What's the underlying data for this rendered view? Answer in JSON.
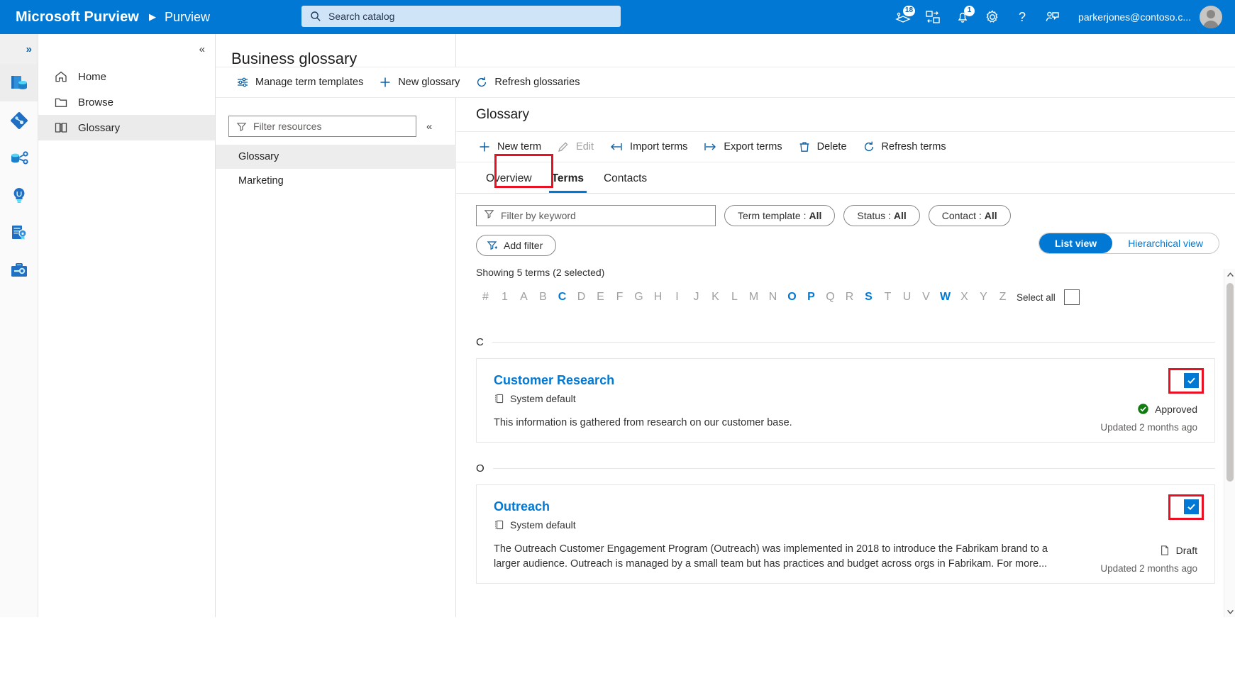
{
  "header": {
    "brand": "Microsoft Purview",
    "separator_icon": "chevron-right-icon",
    "subtitle": "Purview",
    "search": {
      "placeholder": "Search catalog",
      "value": "",
      "icon": "search-icon"
    },
    "icons": [
      {
        "name": "data-estate-icon",
        "badge": "18"
      },
      {
        "name": "portal-switch-icon",
        "badge": ""
      },
      {
        "name": "notifications-bell-icon",
        "badge": "1"
      },
      {
        "name": "settings-gear-icon",
        "badge": ""
      },
      {
        "name": "help-question-icon",
        "badge": ""
      },
      {
        "name": "feedback-person-icon",
        "badge": ""
      }
    ],
    "user_email": "parkerjones@contoso.c...",
    "accent_color": "#0078d4"
  },
  "rail": {
    "expand_label": "»",
    "items": [
      {
        "name": "data-catalog-icon",
        "active": true
      },
      {
        "name": "data-map-icon",
        "active": false
      },
      {
        "name": "data-sharing-icon",
        "active": false
      },
      {
        "name": "data-insights-icon",
        "active": false
      },
      {
        "name": "data-policy-icon",
        "active": false
      },
      {
        "name": "management-icon",
        "active": false
      }
    ]
  },
  "nav": {
    "collapse_label": "«",
    "items": [
      {
        "label": "Home",
        "icon": "home-icon",
        "active": false
      },
      {
        "label": "Browse",
        "icon": "folder-icon",
        "active": false
      },
      {
        "label": "Glossary",
        "icon": "book-icon",
        "active": true
      }
    ]
  },
  "glossary_pane": {
    "page_title": "Business glossary",
    "commands": [
      {
        "label": "Manage term templates",
        "icon": "sliders-icon",
        "disabled": false
      },
      {
        "label": "New glossary",
        "icon": "plus-icon",
        "disabled": false
      },
      {
        "label": "Refresh glossaries",
        "icon": "refresh-icon",
        "disabled": false
      }
    ],
    "filter": {
      "placeholder": "Filter resources",
      "value": "",
      "icon": "funnel-icon"
    },
    "collapse_label": "«",
    "resources": [
      {
        "label": "Glossary",
        "active": true
      },
      {
        "label": "Marketing",
        "active": false
      }
    ]
  },
  "content": {
    "title": "Glossary",
    "commands": [
      {
        "label": "New term",
        "icon": "plus-icon",
        "disabled": false
      },
      {
        "label": "Edit",
        "icon": "pencil-icon",
        "disabled": true
      },
      {
        "label": "Import terms",
        "icon": "import-arrow-icon",
        "disabled": false
      },
      {
        "label": "Export terms",
        "icon": "export-arrow-icon",
        "disabled": false
      },
      {
        "label": "Delete",
        "icon": "trash-icon",
        "disabled": false
      },
      {
        "label": "Refresh terms",
        "icon": "refresh-icon",
        "disabled": false
      }
    ],
    "tabs": [
      {
        "label": "Overview",
        "active": false
      },
      {
        "label": "Terms",
        "active": true,
        "highlighted": true
      },
      {
        "label": "Contacts",
        "active": false
      }
    ],
    "keyword_filter": {
      "placeholder": "Filter by keyword",
      "value": "",
      "icon": "funnel-icon"
    },
    "pills": [
      {
        "label": "Term template :",
        "value": "All"
      },
      {
        "label": "Status :",
        "value": "All"
      },
      {
        "label": "Contact :",
        "value": "All"
      }
    ],
    "add_filter_label": "Add filter",
    "add_filter_icon": "funnel-plus-icon",
    "view_toggle": [
      {
        "label": "List view",
        "selected": true
      },
      {
        "label": "Hierarchical view",
        "selected": false
      }
    ],
    "showing_text": "Showing 5 terms (2 selected)",
    "alphabet": [
      {
        "ch": "#",
        "active": false
      },
      {
        "ch": "1",
        "active": false
      },
      {
        "ch": "A",
        "active": false
      },
      {
        "ch": "B",
        "active": false
      },
      {
        "ch": "C",
        "active": true
      },
      {
        "ch": "D",
        "active": false
      },
      {
        "ch": "E",
        "active": false
      },
      {
        "ch": "F",
        "active": false
      },
      {
        "ch": "G",
        "active": false
      },
      {
        "ch": "H",
        "active": false
      },
      {
        "ch": "I",
        "active": false
      },
      {
        "ch": "J",
        "active": false
      },
      {
        "ch": "K",
        "active": false
      },
      {
        "ch": "L",
        "active": false
      },
      {
        "ch": "M",
        "active": false
      },
      {
        "ch": "N",
        "active": false
      },
      {
        "ch": "O",
        "active": true
      },
      {
        "ch": "P",
        "active": true
      },
      {
        "ch": "Q",
        "active": false
      },
      {
        "ch": "R",
        "active": false
      },
      {
        "ch": "S",
        "active": true
      },
      {
        "ch": "T",
        "active": false
      },
      {
        "ch": "U",
        "active": false
      },
      {
        "ch": "V",
        "active": false
      },
      {
        "ch": "W",
        "active": true
      },
      {
        "ch": "X",
        "active": false
      },
      {
        "ch": "Y",
        "active": false
      },
      {
        "ch": "Z",
        "active": false
      }
    ],
    "select_all_label": "Select all",
    "select_all_checked": false,
    "groups": [
      {
        "letter": "C",
        "terms": [
          {
            "name": "Customer Research",
            "template": "System default",
            "template_icon": "template-icon",
            "description": "This information is gathered from research on our customer base.",
            "status": "Approved",
            "status_icon": "approved-check-icon",
            "status_color": "#107c10",
            "updated": "Updated 2 months ago",
            "selected": true,
            "highlighted": true
          }
        ]
      },
      {
        "letter": "O",
        "terms": [
          {
            "name": "Outreach",
            "template": "System default",
            "template_icon": "template-icon",
            "description": "The Outreach Customer Engagement Program (Outreach) was implemented in 2018 to introduce the Fabrikam brand to a larger audience. Outreach is managed by a small team but has practices and budget across orgs in Fabrikam. For more...",
            "status": "Draft",
            "status_icon": "draft-page-icon",
            "status_color": "#605e5c",
            "updated": "Updated 2 months ago",
            "selected": true,
            "highlighted": true
          }
        ]
      }
    ]
  }
}
